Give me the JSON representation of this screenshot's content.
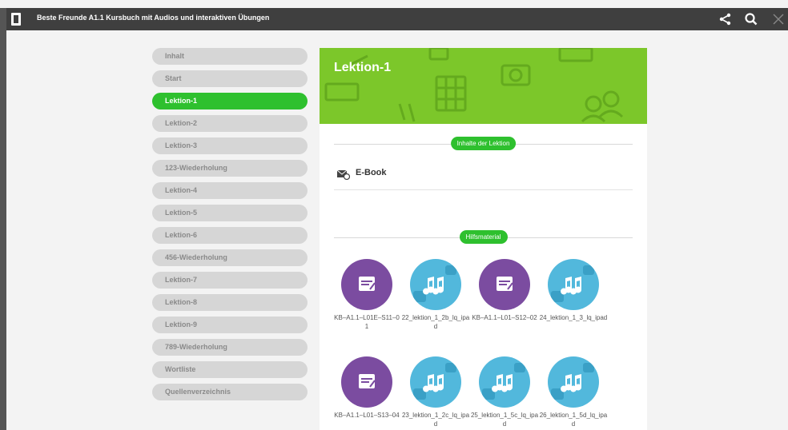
{
  "app": {
    "title": "Beste Freunde A1.1 Kursbuch mit Audios und interaktiven Übungen"
  },
  "toolbar": {
    "share_icon": "share-icon",
    "search_icon": "search-icon",
    "close_icon": "close-icon"
  },
  "sidebar": {
    "items": [
      {
        "label": "Inhalt"
      },
      {
        "label": "Start"
      },
      {
        "label": "Lektion-1",
        "active": true
      },
      {
        "label": "Lektion-2"
      },
      {
        "label": "Lektion-3"
      },
      {
        "label": "123-Wiederholung"
      },
      {
        "label": "Lektion-4"
      },
      {
        "label": "Lektion-5"
      },
      {
        "label": "Lektion-6"
      },
      {
        "label": "456-Wiederholung"
      },
      {
        "label": "Lektion-7"
      },
      {
        "label": "Lektion-8"
      },
      {
        "label": "Lektion-9"
      },
      {
        "label": "789-Wiederholung"
      },
      {
        "label": "Wortliste"
      },
      {
        "label": "Quellenverzeichnis"
      }
    ]
  },
  "main": {
    "title": "Lektion-1",
    "section_contents": "Inhalte der Lektion",
    "ebook_label": "E-Book",
    "section_materials": "Hilfsmaterial",
    "materials": [
      {
        "label": "KB–A1.1–L01E–S11–01",
        "type": "exercise"
      },
      {
        "label": "22_lektion_1_2b_lq_ipad",
        "type": "audio"
      },
      {
        "label": "KB–A1.1–L01–S12–02",
        "type": "exercise"
      },
      {
        "label": "24_lektion_1_3_lq_ipad",
        "type": "audio"
      },
      {
        "label": "KB–A1.1–L01–S13–04",
        "type": "exercise"
      },
      {
        "label": "23_lektion_1_2c_lq_ipad",
        "type": "audio"
      },
      {
        "label": "25_lektion_1_5c_lq_ipad",
        "type": "audio"
      },
      {
        "label": "26_lektion_1_5d_lq_ipad",
        "type": "audio"
      }
    ]
  },
  "colors": {
    "accent_green": "#2ec02e",
    "banner_green": "#7cc72a",
    "exercise_purple": "#7b4ca0",
    "audio_blue": "#52b8dc",
    "topbar": "#3f3f3f"
  }
}
